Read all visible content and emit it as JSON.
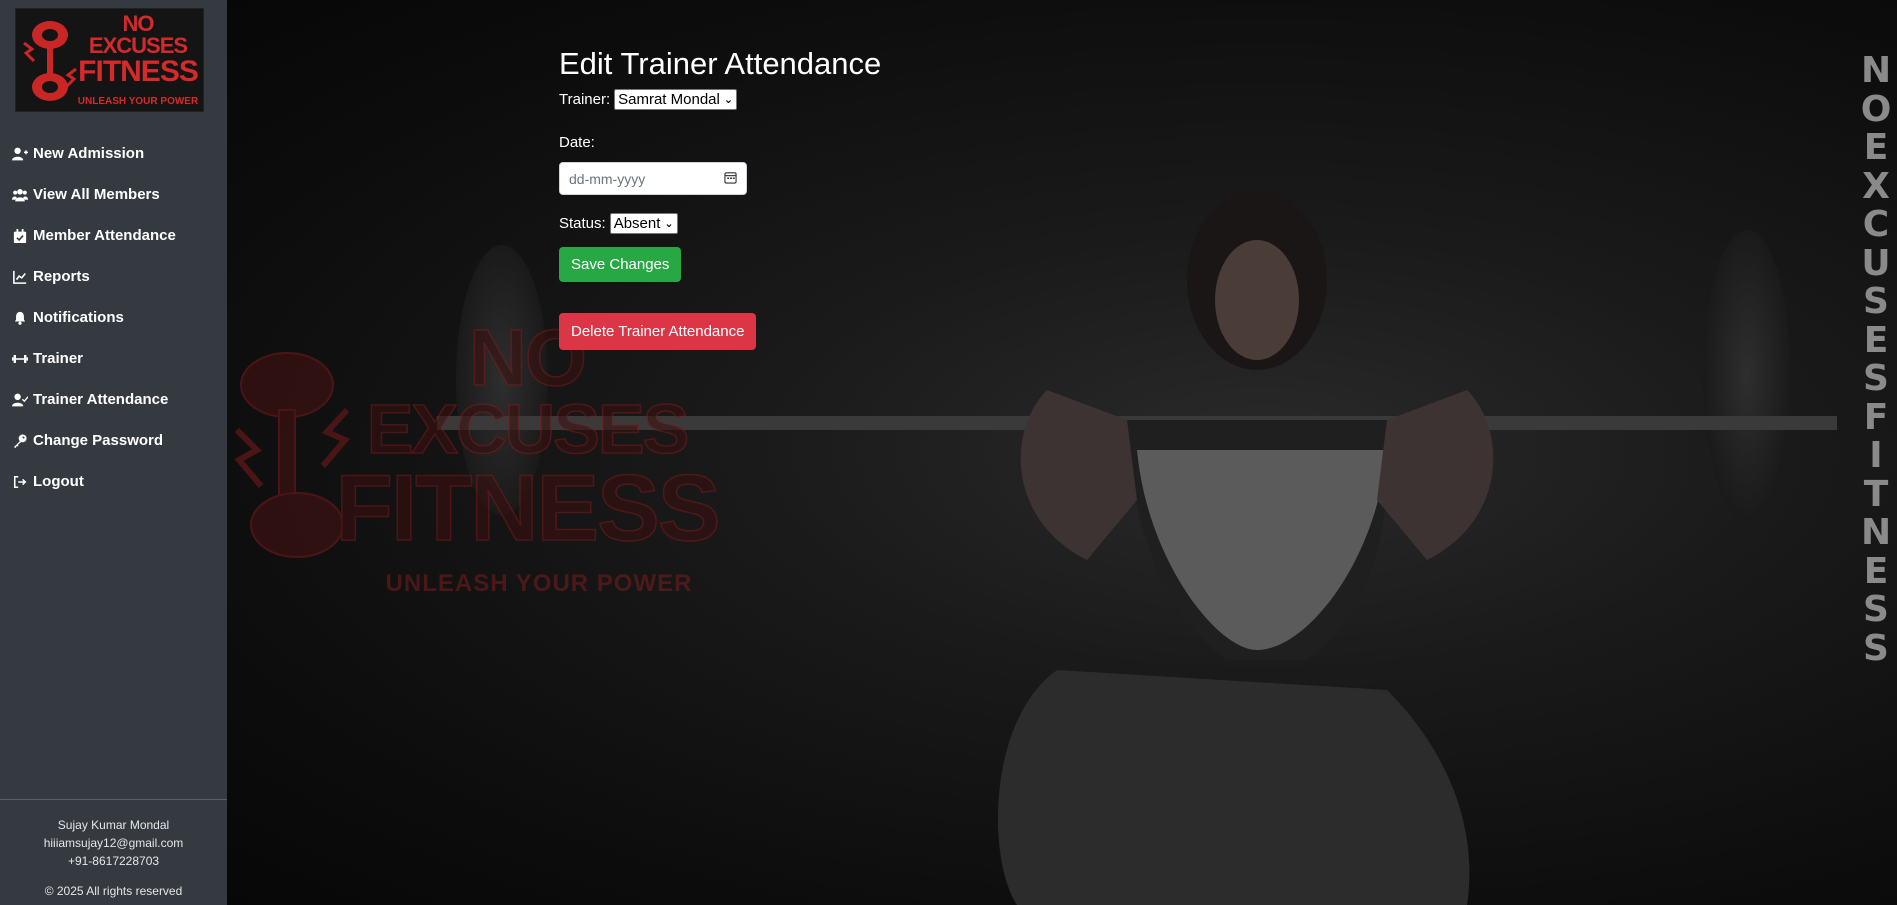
{
  "brand": {
    "logo_lines": [
      "NO",
      "EXCUSES",
      "FITNESS"
    ],
    "tagline": "UNLEASH YOUR POWER",
    "vertical_letters": [
      "N",
      "O",
      "E",
      "X",
      "C",
      "U",
      "S",
      "E",
      "S",
      "F",
      "I",
      "T",
      "N",
      "E",
      "S",
      "S"
    ]
  },
  "sidebar": {
    "items": [
      {
        "label": "New Admission",
        "icon": "user-plus-icon"
      },
      {
        "label": "View All Members",
        "icon": "users-icon"
      },
      {
        "label": "Member Attendance",
        "icon": "calendar-check-icon"
      },
      {
        "label": "Reports",
        "icon": "chart-line-icon"
      },
      {
        "label": "Notifications",
        "icon": "bell-icon"
      },
      {
        "label": "Trainer",
        "icon": "dumbbell-icon"
      },
      {
        "label": "Trainer Attendance",
        "icon": "user-check-icon"
      },
      {
        "label": "Change Password",
        "icon": "key-icon"
      },
      {
        "label": "Logout",
        "icon": "sign-out-icon"
      }
    ],
    "footer": {
      "name": "Sujay Kumar Mondal",
      "email": "hiiiamsujay12@gmail.com",
      "phone": "+91-8617228703",
      "copyright": "© 2025 All rights reserved"
    }
  },
  "form": {
    "title": "Edit Trainer Attendance",
    "trainer_label": "Trainer:",
    "trainer_value": "Samrat Mondal",
    "date_label": "Date:",
    "date_placeholder": "dd-mm-yyyy",
    "status_label": "Status:",
    "status_value": "Absent",
    "save_label": "Save Changes",
    "delete_label": "Delete Trainer Attendance"
  },
  "colors": {
    "sidebar_bg": "#343a40",
    "save_button": "#28a745",
    "delete_button": "#dc3545",
    "brand_red": "#d42a2a"
  }
}
